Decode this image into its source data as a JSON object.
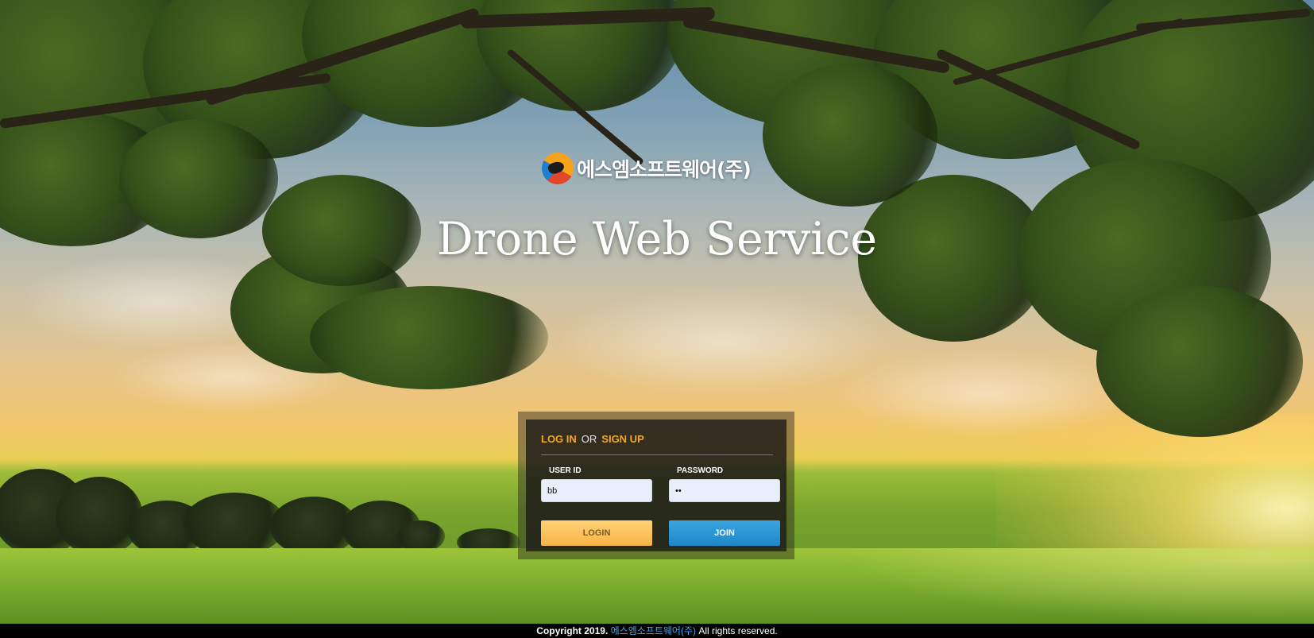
{
  "brand": {
    "logo_icon": "sms-logo-icon",
    "name": "에스엠소프트웨어(주)"
  },
  "title": "Drone Web Service",
  "login": {
    "heading_login": "LOG IN",
    "heading_or": "OR",
    "heading_signup": "SIGN UP",
    "user_id_label": "USER ID",
    "user_id_value": "bb",
    "password_label": "PASSWORD",
    "password_value": "••",
    "login_button": "LOGIN",
    "join_button": "JOIN",
    "colors": {
      "accent": "#f5a623",
      "login_button": "#f7b445",
      "join_button": "#1f86c8"
    }
  },
  "footer": {
    "copyright": "Copyright 2019.",
    "company": "에스엠소프트웨어(주)",
    "rights": "All rights reserved."
  }
}
